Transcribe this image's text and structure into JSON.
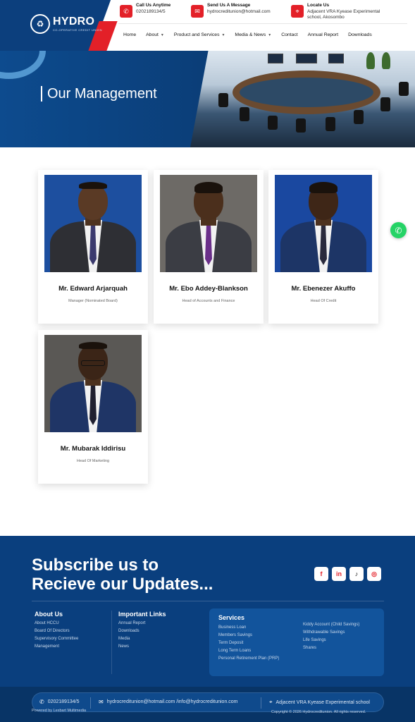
{
  "brand": {
    "name": "HYDRO",
    "tagline": "CO-OPERATIVE CREDIT UNION",
    "colors": {
      "primary": "#0c3f7d",
      "accent": "#e32028"
    }
  },
  "header": {
    "contacts": [
      {
        "icon": "phone-icon",
        "title": "Call Us Anytime",
        "value": "0202189134/5"
      },
      {
        "icon": "mail-icon",
        "title": "Send Us A Message",
        "value": "hydrocreditunion@hotmail.com"
      },
      {
        "icon": "location-icon",
        "title": "Locate Us",
        "value": "Adjacent VRA Kyease Experimental school, Akosombo"
      }
    ],
    "nav": [
      {
        "label": "Home",
        "dropdown": false
      },
      {
        "label": "About",
        "dropdown": true
      },
      {
        "label": "Product and Services",
        "dropdown": true
      },
      {
        "label": "Media & News",
        "dropdown": true
      },
      {
        "label": "Contact",
        "dropdown": false
      },
      {
        "label": "Annual Report",
        "dropdown": false
      },
      {
        "label": "Downloads",
        "dropdown": false
      }
    ]
  },
  "banner": {
    "title": "Our Management"
  },
  "team": [
    {
      "name": "Mr. Edward Arjarquah",
      "role": "Manager (Nominated Board)"
    },
    {
      "name": "Mr. Ebo Addey-Blankson",
      "role": "Head of Accounts and Finance"
    },
    {
      "name": "Mr. Ebenezer Akuffo",
      "role": "Head Of Credit"
    },
    {
      "name": "Mr. Mubarak Iddirisu",
      "role": "Head Of Marketing"
    }
  ],
  "footer": {
    "subscribe_line1": "Subscribe us to",
    "subscribe_line2": "Recieve our Updates...",
    "socials": [
      "facebook-icon",
      "linkedin-icon",
      "tiktok-icon",
      "instagram-icon"
    ],
    "about": {
      "heading": "About Us",
      "items": [
        "About HCCU",
        "Board Of Directors",
        "Supervisory Committee",
        "Management"
      ]
    },
    "links": {
      "heading": "Important Links",
      "items": [
        "Annual Report",
        "Downloads",
        "Media",
        "News"
      ]
    },
    "services": {
      "heading": "Services",
      "col1": [
        "Business Loan",
        "Members Savings",
        "Term Deposit",
        "Long Term Loans",
        "Personal Retirement Plan (PRP)"
      ],
      "col2": [
        "Kiddy Account (Child Savings)",
        "Withdrawable Savings",
        "Life Savings",
        "Shares"
      ]
    },
    "contact_bar": {
      "phone": "0202189134/5",
      "email": "hydrocreditunion@hotmail.com /info@hydrocreditunion.com",
      "address": "Adjacent VRA Kyease Experimental school"
    },
    "powered_by": "Powered by Lexbart Multimedia",
    "copyright": "Copyright © 2026 Hydrocreditunion. All rights reserved."
  }
}
